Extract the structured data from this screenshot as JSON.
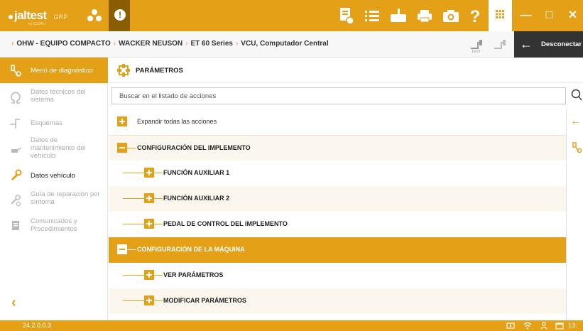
{
  "header": {
    "brand": "jaltest",
    "brand_sub": "GRP",
    "brand_tagline": "by COJALI",
    "minimize": "—",
    "maximize": "□",
    "close": "✕",
    "alert": "!"
  },
  "breadcrumb": {
    "items": [
      "OHW - EQUIPO COMPACTO",
      "WACKER NEUSON",
      "ET 60 Series",
      "VCU, Computador Central"
    ],
    "test_label": "TEST",
    "disconnect_label": "Desconectar"
  },
  "sidebar": {
    "items": [
      {
        "label": "Menú de diagnóstico",
        "icon": "diagnosis-icon",
        "state": "active"
      },
      {
        "label": "Datos técnicos del sistema",
        "icon": "omega-icon",
        "state": "disabled"
      },
      {
        "label": "Esquemas",
        "icon": "schematic-icon",
        "state": "disabled"
      },
      {
        "label": "Datos de mantenimiento del vehículo",
        "icon": "oil-can-icon",
        "state": "disabled"
      },
      {
        "label": "Datos vehículo",
        "icon": "wrench-icon",
        "state": "normal"
      },
      {
        "label": "Guía de reparación por síntoma",
        "icon": "repair-guide-icon",
        "state": "disabled"
      },
      {
        "label": "Comunicados y Procedimientos",
        "icon": "document-icon",
        "state": "disabled"
      }
    ],
    "back": "‹"
  },
  "main": {
    "title": "PARÁMETROS",
    "search_placeholder": "Buscar en el listado de acciones",
    "tree": [
      {
        "label": "Expandir todas las acciones",
        "level": 0,
        "kind": "expand-all"
      },
      {
        "label": "CONFIGURACIÓN DEL IMPLEMENTO",
        "level": 0,
        "kind": "group-open"
      },
      {
        "label": "FUNCIÓN AUXILIAR 1",
        "level": 1,
        "kind": "leaf"
      },
      {
        "label": "FUNCIÓN AUXILIAR 2",
        "level": 1,
        "kind": "leaf"
      },
      {
        "label": "PEDAL DE CONTROL DEL IMPLEMENTO",
        "level": 1,
        "kind": "leaf"
      },
      {
        "label": "CONFIGURACIÓN DE LA MÁQUINA",
        "level": 0,
        "kind": "group-open-selected"
      },
      {
        "label": "VER PARÁMETROS",
        "level": 1,
        "kind": "leaf"
      },
      {
        "label": "MODIFICAR PARÁMETROS",
        "level": 1,
        "kind": "leaf"
      }
    ]
  },
  "status": {
    "version": "24.2.0.0.3",
    "time": "13:"
  },
  "colors": {
    "accent": "#e4a117",
    "dark": "#333333",
    "alert_tab": "#8a5d00"
  }
}
